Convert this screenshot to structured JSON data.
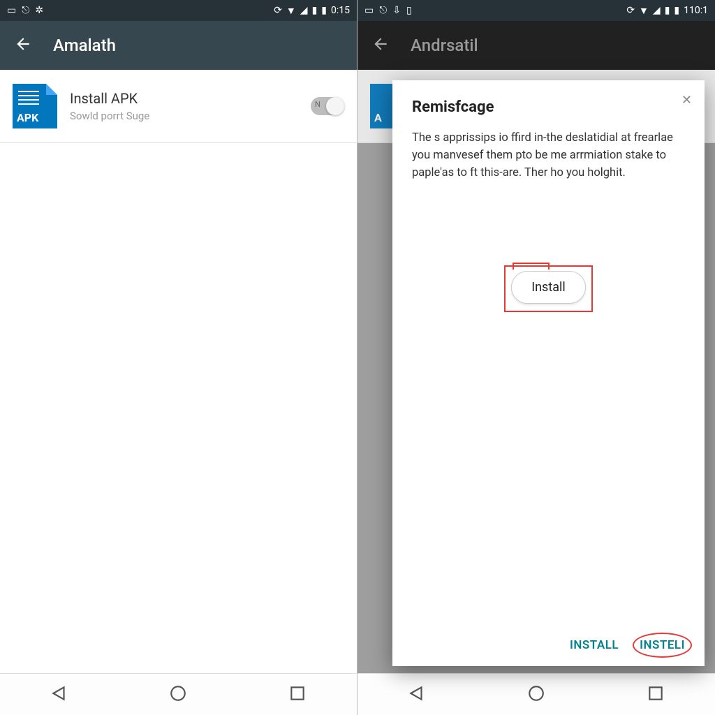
{
  "left": {
    "status": {
      "time": "0:15"
    },
    "appbar": {
      "title": "Amalath"
    },
    "row": {
      "icon_label": "APK",
      "title": "Install APK",
      "subtitle": "Sowld porrt Suge",
      "toggle_state": "N"
    }
  },
  "right": {
    "status": {
      "time": "110:1"
    },
    "appbar": {
      "title": "Andrsatil"
    },
    "bg_row": {
      "icon_label": "A"
    },
    "dialog": {
      "title": "Remisfcage",
      "body": "The s apprissips io ffird in-the deslatidial at frearlae you manvesef them pto be me arrmiation stake to paple'as to ft this-are. Ther ho you holghit.",
      "pill_label": "Install",
      "actions": {
        "left": "INSTALL",
        "right": "INSTELI"
      }
    }
  }
}
